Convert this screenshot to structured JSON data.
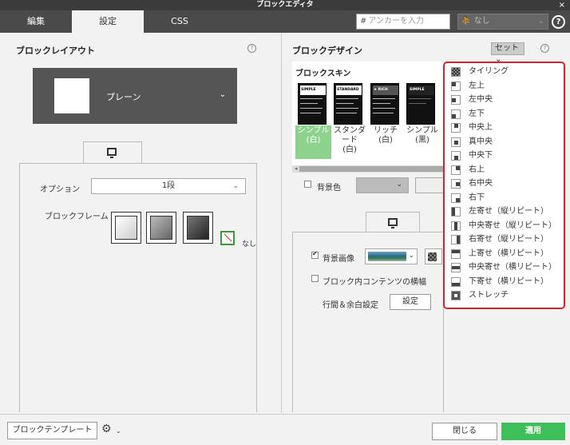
{
  "window": {
    "title": "ブロックエディタ",
    "close": "×"
  },
  "tabs": [
    {
      "label": "編集"
    },
    {
      "label": "設定"
    },
    {
      "label": "CSS"
    }
  ],
  "header": {
    "anchor_placeholder": "アンカーを入力",
    "style_select": "なし",
    "help": "?"
  },
  "left": {
    "title": "ブロックレイアウト",
    "layout_value": "プレーン",
    "option_label": "オプション",
    "option_value": "1段",
    "frame_label": "ブロックフレーム",
    "frame_none": "なし"
  },
  "right": {
    "title": "ブロックデザイン",
    "set_button": "セット",
    "skin_label": "ブロックスキン",
    "skins": [
      {
        "label": "シンプル\n(白)",
        "head": "SIMPLE"
      },
      {
        "label": "スタンダ\nード\n(白)",
        "head": "STANDARD"
      },
      {
        "label": "リッチ\n(白)",
        "head": "★ RICH"
      },
      {
        "label": "シンプル\n(黒)",
        "head": "SIMPLE"
      }
    ],
    "bg_color_label": "背景色",
    "bg_image_label": "背景画像",
    "content_width_label": "ブロック内コンテンツの横幅",
    "spacing_label": "行間＆余白設定",
    "spacing_button": "設定"
  },
  "dropdown": {
    "items": [
      {
        "label": "タイリング",
        "icon": "tiling-icon"
      },
      {
        "label": "左上",
        "icon": "top-left-icon"
      },
      {
        "label": "左中央",
        "icon": "middle-left-icon"
      },
      {
        "label": "左下",
        "icon": "bottom-left-icon"
      },
      {
        "label": "中央上",
        "icon": "top-center-icon"
      },
      {
        "label": "真中央",
        "icon": "center-icon"
      },
      {
        "label": "中央下",
        "icon": "bottom-center-icon"
      },
      {
        "label": "右上",
        "icon": "top-right-icon"
      },
      {
        "label": "右中央",
        "icon": "middle-right-icon"
      },
      {
        "label": "右下",
        "icon": "bottom-right-icon"
      },
      {
        "label": "左寄せ（縦リピート）",
        "icon": "left-repeat-y-icon"
      },
      {
        "label": "中央寄せ（縦リピート）",
        "icon": "center-repeat-y-icon"
      },
      {
        "label": "右寄せ（縦リピート）",
        "icon": "right-repeat-y-icon"
      },
      {
        "label": "上寄せ（横リピート）",
        "icon": "top-repeat-x-icon"
      },
      {
        "label": "中央寄せ（横リピート）",
        "icon": "middle-repeat-x-icon"
      },
      {
        "label": "下寄せ（横リピート）",
        "icon": "bottom-repeat-x-icon"
      },
      {
        "label": "ストレッチ",
        "icon": "stretch-icon"
      }
    ]
  },
  "footer": {
    "template_button": "ブロックテンプレート",
    "close_button": "閉じる",
    "apply_button": "適用"
  },
  "colors": {
    "accent": "#3fbf5a",
    "highlight": "#d9232e",
    "dark": "#4a4a4a"
  }
}
